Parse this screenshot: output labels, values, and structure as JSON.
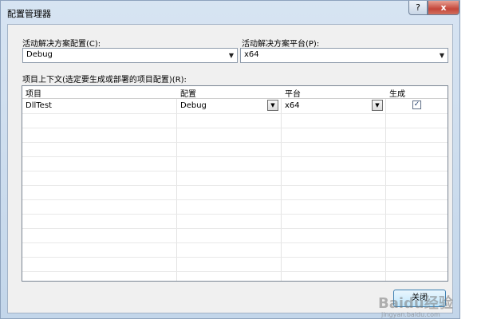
{
  "window": {
    "title": "配置管理器",
    "help_label": "?",
    "close_label": "x"
  },
  "active_config": {
    "label": "活动解决方案配置(C):",
    "value": "Debug"
  },
  "active_platform": {
    "label": "活动解决方案平台(P):",
    "value": "x64"
  },
  "project_contexts": {
    "label": "项目上下文(选定要生成或部署的项目配置)(R):",
    "columns": [
      "项目",
      "配置",
      "平台",
      "生成"
    ],
    "rows": [
      {
        "project": "DllTest",
        "configuration": "Debug",
        "platform": "x64",
        "build": true
      }
    ]
  },
  "close_button": {
    "label": "关闭"
  },
  "watermark": {
    "text": "Baidu经验",
    "url": "jingyan.baidu.com"
  },
  "colors": {
    "title_bg": "#c3d6ea",
    "close_red": "#c4463a",
    "client_bg": "#f0f0f0"
  }
}
